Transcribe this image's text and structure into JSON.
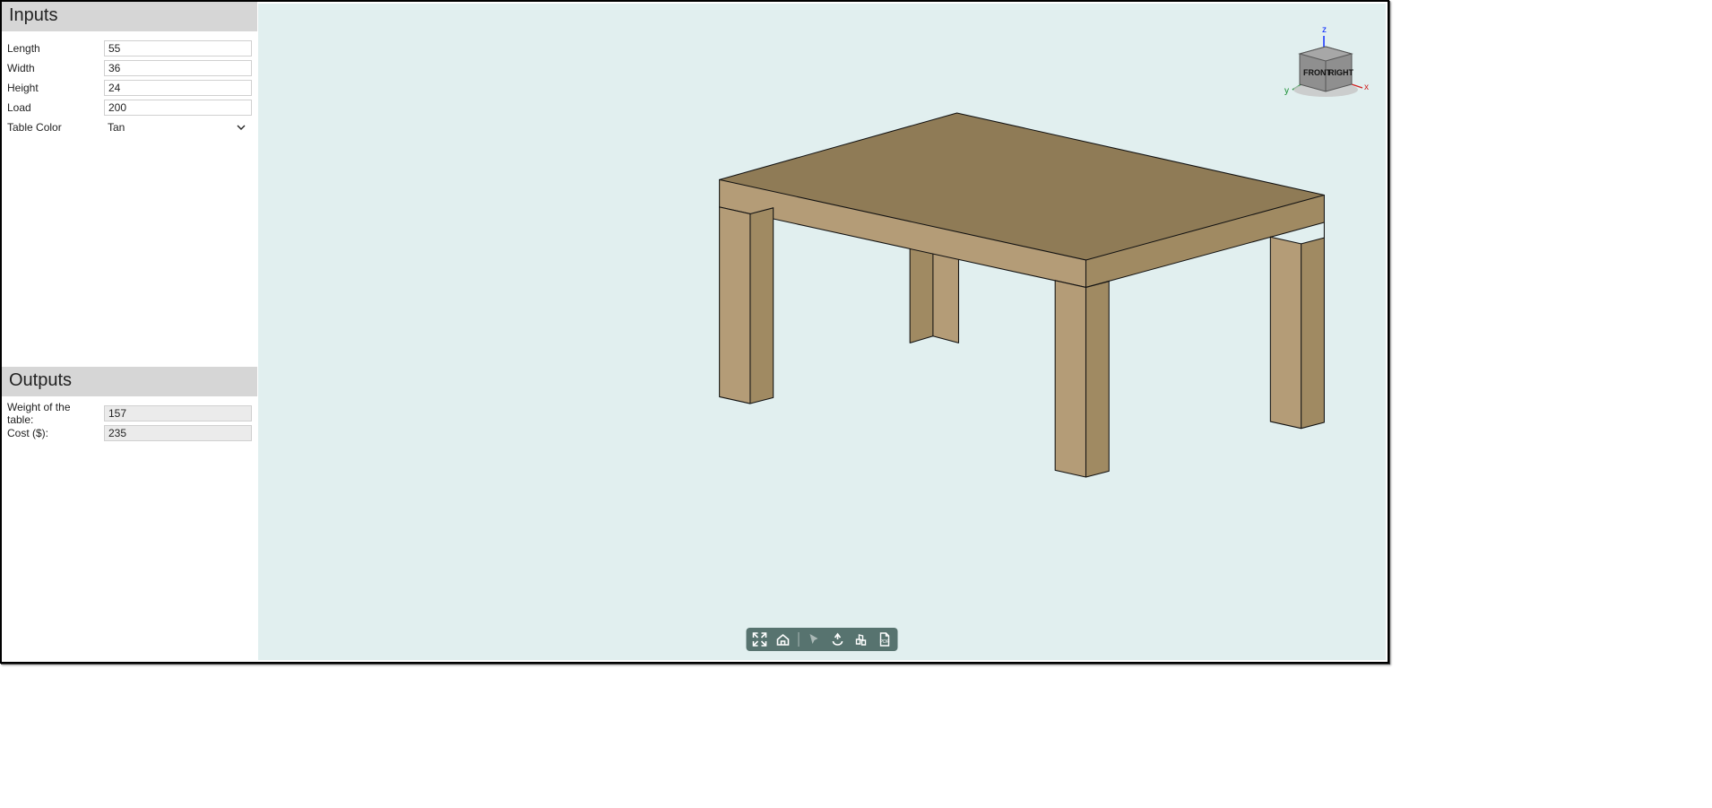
{
  "panels": {
    "inputs_title": "Inputs",
    "outputs_title": "Outputs"
  },
  "inputs": {
    "length": {
      "label": "Length",
      "value": "55"
    },
    "width": {
      "label": "Width",
      "value": "36"
    },
    "height": {
      "label": "Height",
      "value": "24"
    },
    "load": {
      "label": "Load",
      "value": "200"
    },
    "color": {
      "label": "Table Color",
      "value": "Tan"
    }
  },
  "outputs": {
    "weight": {
      "label": "Weight of the table:",
      "value": "157"
    },
    "cost": {
      "label": "Cost ($):",
      "value": "235"
    }
  },
  "viewcube": {
    "axes": {
      "x": "x",
      "y": "y",
      "z": "z"
    },
    "faces": {
      "front": "FRONT",
      "right": "RIGHT"
    }
  },
  "toolbar_names": {
    "fullscreen": "fullscreen-icon",
    "home": "home-icon",
    "select": "cursor-icon",
    "push": "push-icon",
    "section": "section-icon",
    "pdf": "pdf-icon"
  }
}
